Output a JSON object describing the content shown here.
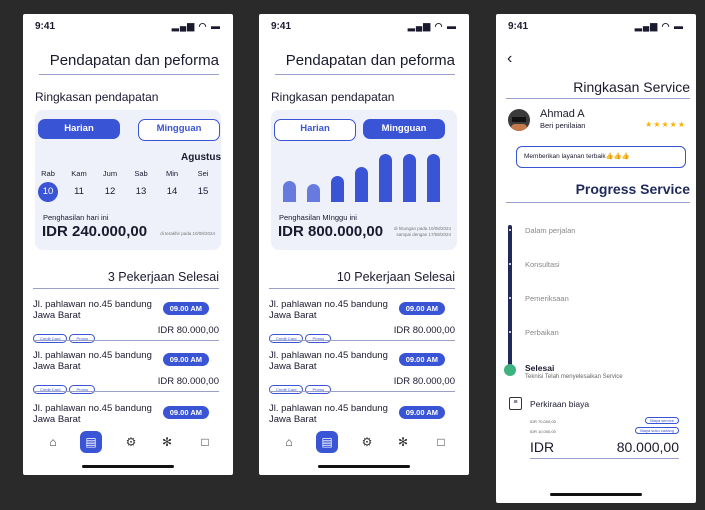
{
  "status": {
    "time": "9:41",
    "icons": "▂▄▆ ◠ ▬"
  },
  "screen1": {
    "title": "Pendapatan dan peforma",
    "section": "Ringkasan pendapatan",
    "tab_daily": "Harian",
    "tab_weekly": "Mingguan",
    "month": "Agustus",
    "days": [
      {
        "name": "Rab",
        "num": "10"
      },
      {
        "name": "Kam",
        "num": "11"
      },
      {
        "name": "Jum",
        "num": "12"
      },
      {
        "name": "Sab",
        "num": "13"
      },
      {
        "name": "Min",
        "num": "14"
      },
      {
        "name": "Sei",
        "num": "15"
      }
    ],
    "income_label": "Penghasilan hari ini",
    "income": "IDR 240.000,00",
    "income_note": "di terakhir pada 10/08/2024",
    "jobs_heading": "3 Pekerjaan Selesai"
  },
  "screen2": {
    "title": "Pendapatan dan peforma",
    "section": "Ringkasan pendapatan",
    "tab_daily": "Harian",
    "tab_weekly": "Mingguan",
    "bars": [
      0.38,
      0.32,
      0.46,
      0.62,
      0.86,
      0.86,
      0.86
    ],
    "income_label": "Penghasilan MInggu ini",
    "income": "IDR 800.000,00",
    "income_note1": "di hitungan pada 10/08/2024",
    "income_note2": "sampai dengan 17/08/2024",
    "jobs_heading": "10 Pekerjaan Selesai"
  },
  "job": {
    "address": "Jl. pahlawan no.45 bandung Jawa Barat",
    "time": "09.00 AM",
    "tag1": "Credit Card",
    "tag2": "Promo",
    "price": "IDR 80.000,00"
  },
  "screen3": {
    "back": "‹",
    "title": "Ringkasan Service",
    "user_name": "Ahmad A",
    "user_sub": "Beri penilaian",
    "stars": "★★★★★",
    "review": "Memberikan layanan terbaik👍👍👍",
    "progress_title": "Progress Service",
    "steps": [
      "Dalam perjalan",
      "Konsultasi",
      "Pemeriksaan",
      "Perbaikan"
    ],
    "done_title": "Selesai",
    "done_sub": "Teknisi Telah menyelesaikan Service",
    "estimate_label": "Perkiraan biaya",
    "line1_amount": "IDR 70.000,00",
    "line1_label": "Biaya service",
    "line2_amount": "IDR 10.000,00",
    "line2_label": "Biaya suku cadang",
    "total_currency": "IDR",
    "total_amount": "80.000,00"
  },
  "colors": {
    "accent": "#3a54d6",
    "navy": "#1f2a5a",
    "success": "#3fb37f",
    "star": "#f5b400"
  }
}
